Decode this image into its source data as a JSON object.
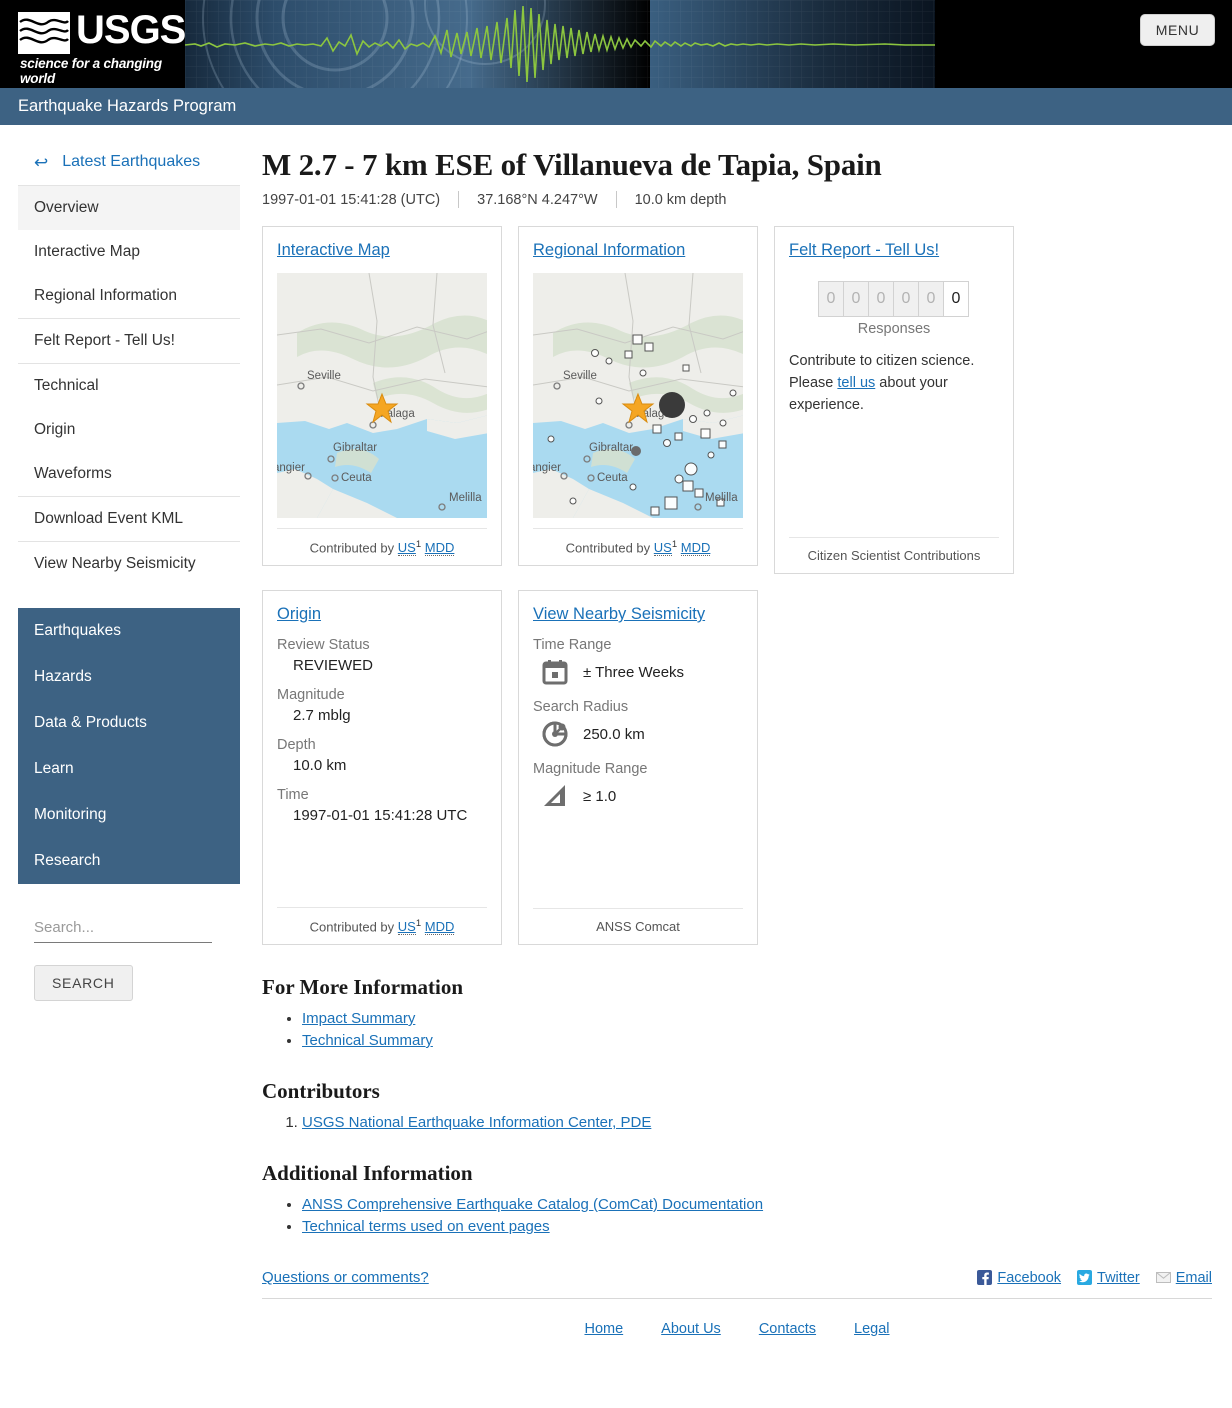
{
  "header": {
    "logo_word": "USGS",
    "logo_tagline": "science for a changing world",
    "menu_label": "MENU",
    "program_title": "Earthquake Hazards Program"
  },
  "sidebar": {
    "back_label": "Latest Earthquakes",
    "back_icon": "left-arrow-icon",
    "nav_groups": [
      [
        "Overview",
        "Interactive Map",
        "Regional Information"
      ],
      [
        "Felt Report - Tell Us!"
      ],
      [
        "Technical",
        "Origin",
        "Waveforms"
      ],
      [
        "Download Event KML"
      ],
      [
        "View Nearby Seismicity"
      ]
    ],
    "active_item": "Overview",
    "blue_nav": [
      "Earthquakes",
      "Hazards",
      "Data & Products",
      "Learn",
      "Monitoring",
      "Research"
    ],
    "search_placeholder": "Search...",
    "search_value": "",
    "search_button": "SEARCH"
  },
  "event": {
    "title": "M 2.7 - 7 km ESE of Villanueva de Tapia, Spain",
    "time": "1997-01-01 15:41:28 (UTC)",
    "coordinates": "37.168°N 4.247°W",
    "depth": "10.0 km depth"
  },
  "cards": {
    "interactive_map": {
      "title": "Interactive Map",
      "contributed_prefix": "Contributed by",
      "contributor_a": "US",
      "contributor_sup": "1",
      "contributor_b": "MDD",
      "map_labels": [
        "Seville",
        "Málaga",
        "Gibraltar",
        "angier",
        "Ceuta",
        "Melilla"
      ]
    },
    "regional_information": {
      "title": "Regional Information",
      "contributed_prefix": "Contributed by",
      "contributor_a": "US",
      "contributor_sup": "1",
      "contributor_b": "MDD",
      "map_labels": [
        "Seville",
        "Málaga",
        "Gibraltar",
        "angier",
        "Ceuta",
        "Melilla"
      ]
    },
    "felt_report": {
      "title": "Felt Report - Tell Us!",
      "odometer_digits": [
        "0",
        "0",
        "0",
        "0",
        "0",
        "0"
      ],
      "responses_label": "Responses",
      "body_part1": "Contribute to citizen science. Please ",
      "body_link": "tell us",
      "body_part2": " about your experience.",
      "footer": "Citizen Scientist Contributions"
    },
    "origin": {
      "title": "Origin",
      "rows": [
        {
          "label": "Review Status",
          "value": "REVIEWED"
        },
        {
          "label": "Magnitude",
          "value": "2.7 mblg"
        },
        {
          "label": "Depth",
          "value": "10.0 km"
        },
        {
          "label": "Time",
          "value": "1997-01-01 15:41:28 UTC"
        }
      ],
      "contributed_prefix": "Contributed by",
      "contributor_a": "US",
      "contributor_sup": "1",
      "contributor_b": "MDD"
    },
    "nearby_seismicity": {
      "title": "View Nearby Seismicity",
      "rows": [
        {
          "label": "Time Range",
          "icon": "calendar-icon",
          "value": "± Three Weeks"
        },
        {
          "label": "Search Radius",
          "icon": "search-radius-icon",
          "value": "250.0 km"
        },
        {
          "label": "Magnitude Range",
          "icon": "magnitude-icon",
          "value": "≥ 1.0"
        }
      ],
      "footer": "ANSS Comcat"
    }
  },
  "sections": {
    "more_info_heading": "For More Information",
    "more_info_links": [
      "Impact Summary",
      "Technical Summary"
    ],
    "contributors_heading": "Contributors",
    "contributors_links": [
      "USGS National Earthquake Information Center, PDE"
    ],
    "additional_heading": "Additional Information",
    "additional_links": [
      "ANSS Comprehensive Earthquake Catalog (ComCat) Documentation",
      "Technical terms used on event pages"
    ]
  },
  "footer": {
    "questions_label": "Questions or comments?",
    "social": [
      {
        "label": "Facebook",
        "icon": "facebook-icon",
        "color": "#3b5998"
      },
      {
        "label": "Twitter",
        "icon": "twitter-icon",
        "color": "#29a9e1"
      },
      {
        "label": "Email",
        "icon": "email-icon",
        "color": "#cccccc"
      }
    ],
    "bottom_links": [
      "Home",
      "About Us",
      "Contacts",
      "Legal"
    ]
  },
  "colors": {
    "usgs_blue": "#3d6283",
    "link_blue": "#1a71b8",
    "waveform_green": "#8cc63f",
    "star_orange": "#f5a623",
    "map_land": "#eeeeea",
    "map_water": "#aadaf0"
  }
}
